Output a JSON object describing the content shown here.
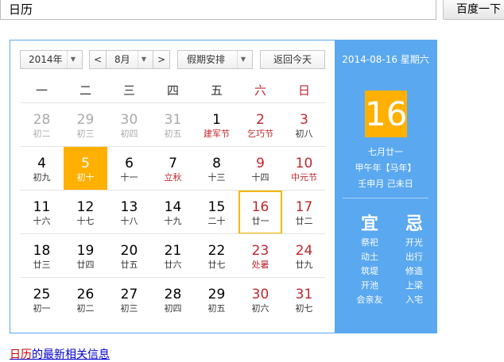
{
  "search": {
    "query": "日历",
    "button_label": "百度一下"
  },
  "controls": {
    "year": "2014年",
    "month": "8月",
    "prev_month": "<",
    "next_month": ">",
    "holiday": "假期安排",
    "today_button": "返回今天",
    "caret": "▼"
  },
  "weekdays": [
    "一",
    "二",
    "三",
    "四",
    "五",
    "六",
    "日"
  ],
  "weeks": [
    [
      {
        "d": "28",
        "l": "初二",
        "other": true
      },
      {
        "d": "29",
        "l": "初三",
        "other": true
      },
      {
        "d": "30",
        "l": "初四",
        "other": true
      },
      {
        "d": "31",
        "l": "初五",
        "other": true
      },
      {
        "d": "1",
        "l": "建军节",
        "holiday": true
      },
      {
        "d": "2",
        "l": "乞巧节",
        "holiday": true,
        "weekend": true
      },
      {
        "d": "3",
        "l": "初八",
        "weekend": true
      }
    ],
    [
      {
        "d": "4",
        "l": "初九"
      },
      {
        "d": "5",
        "l": "初十",
        "highlight": true
      },
      {
        "d": "6",
        "l": "十一"
      },
      {
        "d": "7",
        "l": "立秋",
        "holiday": true
      },
      {
        "d": "8",
        "l": "十三"
      },
      {
        "d": "9",
        "l": "十四",
        "weekend": true
      },
      {
        "d": "10",
        "l": "中元节",
        "holiday": true,
        "weekend": true
      }
    ],
    [
      {
        "d": "11",
        "l": "十六"
      },
      {
        "d": "12",
        "l": "十七"
      },
      {
        "d": "13",
        "l": "十八"
      },
      {
        "d": "14",
        "l": "十九"
      },
      {
        "d": "15",
        "l": "二十"
      },
      {
        "d": "16",
        "l": "廿一",
        "weekend": true,
        "selected": true
      },
      {
        "d": "17",
        "l": "廿二",
        "weekend": true
      }
    ],
    [
      {
        "d": "18",
        "l": "廿三"
      },
      {
        "d": "19",
        "l": "廿四"
      },
      {
        "d": "20",
        "l": "廿五"
      },
      {
        "d": "21",
        "l": "廿六"
      },
      {
        "d": "22",
        "l": "廿七"
      },
      {
        "d": "23",
        "l": "处暑",
        "holiday": true,
        "weekend": true
      },
      {
        "d": "24",
        "l": "廿九",
        "weekend": true
      }
    ],
    [
      {
        "d": "25",
        "l": "初一"
      },
      {
        "d": "26",
        "l": "初二"
      },
      {
        "d": "27",
        "l": "初三"
      },
      {
        "d": "28",
        "l": "初四"
      },
      {
        "d": "29",
        "l": "初五"
      },
      {
        "d": "30",
        "l": "初六",
        "weekend": true
      },
      {
        "d": "31",
        "l": "初七",
        "weekend": true
      }
    ]
  ],
  "side": {
    "date": "2014-08-16 星期六",
    "day": "16",
    "lunar_date": "七月廿一",
    "ganzhi_year": "甲午年【马年】",
    "ganzhi_month_day": "壬申月 己未日",
    "yi_title": "宜",
    "ji_title": "忌",
    "yi": [
      "祭祀",
      "动土",
      "筑堤",
      "开池",
      "会亲友"
    ],
    "ji": [
      "开光",
      "出行",
      "修造",
      "上梁",
      "入宅"
    ]
  },
  "footer": {
    "highlight": "日历",
    "rest": "的最新相关信息"
  },
  "colors": {
    "accent_blue": "#5aa8f0",
    "highlight_orange": "#ffb000",
    "weekend_red": "#c0272d"
  }
}
